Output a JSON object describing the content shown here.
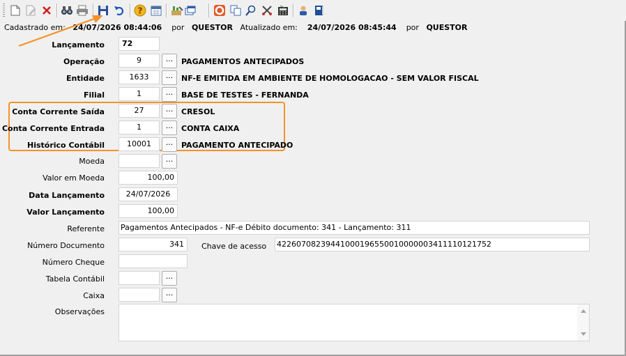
{
  "toolbar": {
    "icons": [
      "new-document-icon",
      "edit-document-icon",
      "delete-icon",
      "binoculars-search-icon",
      "print-icon",
      "save-icon",
      "undo-icon",
      "help-icon",
      "calendar-icon",
      "tools-report-icon",
      "windows-dropdown-icon",
      "lifebuoy-icon",
      "copy-icon",
      "magnifier-icon",
      "scissors-tools-icon",
      "calculator-icon",
      "user-icon",
      "book-icon"
    ]
  },
  "header": {
    "created_label": "Cadastrado em:",
    "created_at": "24/07/2026 08:44:06",
    "by1": "por",
    "created_by": "QUESTOR",
    "updated_label": "Atualizado em:",
    "updated_at": "24/07/2026 08:45:44",
    "by2": "por",
    "updated_by": "QUESTOR"
  },
  "form": {
    "lancamento": {
      "label": "Lançamento",
      "value": "72"
    },
    "operacao": {
      "label": "Operação",
      "value": "9",
      "desc": "PAGAMENTOS ANTECIPADOS"
    },
    "entidade": {
      "label": "Entidade",
      "value": "1633",
      "desc": "NF-E EMITIDA EM AMBIENTE DE HOMOLOGACAO - SEM VALOR FISCAL"
    },
    "filial": {
      "label": "Filial",
      "value": "1",
      "desc": "BASE DE TESTES - FERNANDA"
    },
    "cc_saida": {
      "label": "Conta Corrente Saída",
      "value": "27",
      "desc": "CRESOL"
    },
    "cc_entrada": {
      "label": "Conta Corrente Entrada",
      "value": "1",
      "desc": "CONTA CAIXA"
    },
    "historico": {
      "label": "Histórico Contábil",
      "value": "10001",
      "desc": "PAGAMENTO ANTECIPADO"
    },
    "moeda": {
      "label": "Moeda",
      "value": ""
    },
    "valor_moeda": {
      "label": "Valor em Moeda",
      "value": "100,00"
    },
    "data_lanc": {
      "label": "Data Lançamento",
      "value": "24/07/2026"
    },
    "valor_lanc": {
      "label": "Valor Lançamento",
      "value": "100,00"
    },
    "referente": {
      "label": "Referente",
      "value": "Pagamentos Antecipados - NF-e Débito documento: 341 - Lançamento: 311"
    },
    "num_doc": {
      "label": "Número Documento",
      "value": "341"
    },
    "chave": {
      "label": "Chave de acesso",
      "value": "42260708239441000196550010000003411110121752"
    },
    "num_cheque": {
      "label": "Número Cheque",
      "value": ""
    },
    "tabela_contabil": {
      "label": "Tabela Contábil",
      "value": ""
    },
    "caixa": {
      "label": "Caixa",
      "value": ""
    },
    "observacoes": {
      "label": "Observações",
      "value": ""
    }
  },
  "lookup_label": "...",
  "colors": {
    "highlight": "#f4922a",
    "background": "#f0f0f0"
  }
}
